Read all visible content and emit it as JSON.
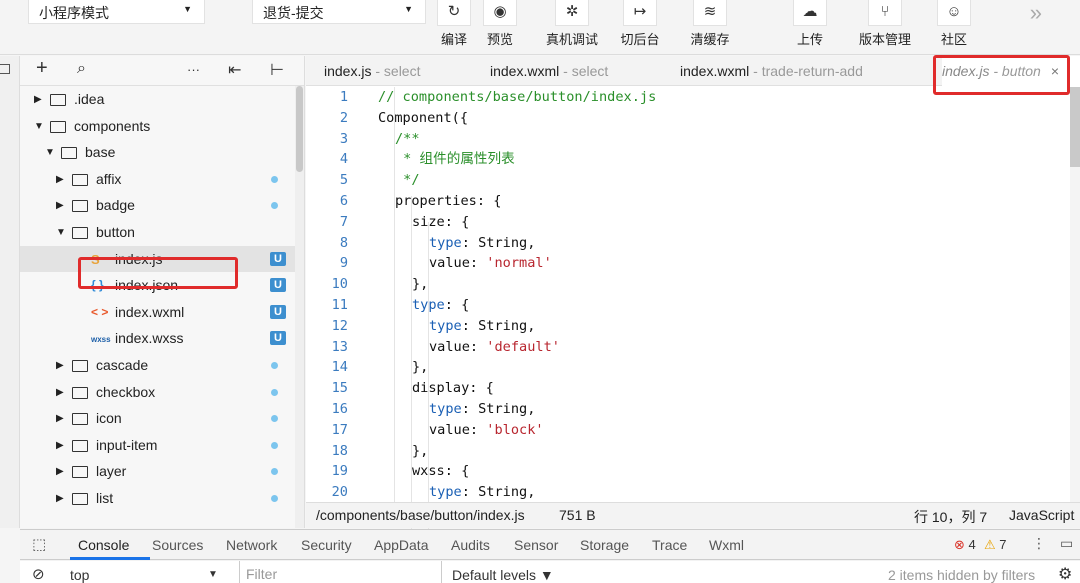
{
  "toolbar": {
    "mode_select": "小程序模式",
    "compile_select": "退货-提交",
    "buttons": [
      {
        "label": "编译",
        "icon": "refresh-icon",
        "glyph": "↻"
      },
      {
        "label": "预览",
        "icon": "eye-icon",
        "glyph": "◉"
      },
      {
        "label": "真机调试",
        "icon": "bug-icon",
        "glyph": "✲"
      },
      {
        "label": "切后台",
        "icon": "switch-background-icon",
        "glyph": "↦"
      },
      {
        "label": "清缓存",
        "icon": "layers-icon",
        "glyph": "≋"
      },
      {
        "label": "上传",
        "icon": "cloud-upload-icon",
        "glyph": "☁"
      },
      {
        "label": "版本管理",
        "icon": "branch-icon",
        "glyph": "⑂"
      },
      {
        "label": "社区",
        "icon": "chat-icon",
        "glyph": "☺"
      }
    ],
    "more_glyph": "»"
  },
  "explorer": {
    "tools": {
      "add": "+",
      "search": "⌕",
      "more": "···",
      "collapse": "⇤",
      "split": "⊢"
    },
    "tree": [
      {
        "name": ".idea",
        "level": 0,
        "type": "folder",
        "expanded": false
      },
      {
        "name": "components",
        "level": 0,
        "type": "folder",
        "expanded": true
      },
      {
        "name": "base",
        "level": 1,
        "type": "folder",
        "expanded": true
      },
      {
        "name": "affix",
        "level": 2,
        "type": "folder",
        "expanded": false,
        "status": "dot"
      },
      {
        "name": "badge",
        "level": 2,
        "type": "folder",
        "expanded": false,
        "status": "dot"
      },
      {
        "name": "button",
        "level": 2,
        "type": "folder",
        "expanded": true
      },
      {
        "name": "index.js",
        "level": 3,
        "type": "js",
        "status": "U",
        "selected": true
      },
      {
        "name": "index.json",
        "level": 3,
        "type": "json",
        "status": "U"
      },
      {
        "name": "index.wxml",
        "level": 3,
        "type": "wxml",
        "status": "U"
      },
      {
        "name": "index.wxss",
        "level": 3,
        "type": "wxss",
        "status": "U"
      },
      {
        "name": "cascade",
        "level": 2,
        "type": "folder",
        "expanded": false,
        "status": "dot"
      },
      {
        "name": "checkbox",
        "level": 2,
        "type": "folder",
        "expanded": false,
        "status": "dot"
      },
      {
        "name": "icon",
        "level": 2,
        "type": "folder",
        "expanded": false,
        "status": "dot"
      },
      {
        "name": "input-item",
        "level": 2,
        "type": "folder",
        "expanded": false,
        "status": "dot"
      },
      {
        "name": "layer",
        "level": 2,
        "type": "folder",
        "expanded": false,
        "status": "dot"
      },
      {
        "name": "list",
        "level": 2,
        "type": "folder",
        "expanded": false,
        "status": "dot"
      }
    ],
    "icon_glyphs": {
      "js": "S",
      "json": "{ }",
      "wxml": "< >",
      "wxss": "wxss"
    }
  },
  "editor": {
    "tabs": [
      {
        "file": "index.js",
        "dir": " - select"
      },
      {
        "file": "index.wxml",
        "dir": " - select"
      },
      {
        "file": "index.wxml",
        "dir": " - trade-return-add"
      },
      {
        "file": "index.js",
        "dir": " - button",
        "active": true,
        "close": "×"
      }
    ],
    "lines": [
      {
        "n": "1",
        "indent": 0,
        "t": [
          [
            "c-comment",
            "// components/base/button/index.js"
          ]
        ]
      },
      {
        "n": "2",
        "indent": 0,
        "t": [
          [
            "",
            "Component({"
          ]
        ]
      },
      {
        "n": "3",
        "indent": 1,
        "t": [
          [
            "c-comment",
            "/**"
          ]
        ]
      },
      {
        "n": "4",
        "indent": 1,
        "t": [
          [
            "c-comment",
            " * 组件的属性列表"
          ]
        ]
      },
      {
        "n": "5",
        "indent": 1,
        "t": [
          [
            "c-comment",
            " */"
          ]
        ]
      },
      {
        "n": "6",
        "indent": 1,
        "t": [
          [
            "",
            "properties: {"
          ]
        ]
      },
      {
        "n": "7",
        "indent": 2,
        "t": [
          [
            "",
            "size: {"
          ]
        ]
      },
      {
        "n": "8",
        "indent": 3,
        "t": [
          [
            "c-key",
            "type"
          ],
          [
            "",
            ": String,"
          ]
        ]
      },
      {
        "n": "9",
        "indent": 3,
        "t": [
          [
            "",
            "value: "
          ],
          [
            "c-str",
            "'normal'"
          ]
        ]
      },
      {
        "n": "10",
        "indent": 2,
        "t": [
          [
            "",
            "},"
          ]
        ]
      },
      {
        "n": "11",
        "indent": 2,
        "t": [
          [
            "c-key",
            "type"
          ],
          [
            "",
            ": {"
          ]
        ]
      },
      {
        "n": "12",
        "indent": 3,
        "t": [
          [
            "c-key",
            "type"
          ],
          [
            "",
            ": String,"
          ]
        ]
      },
      {
        "n": "13",
        "indent": 3,
        "t": [
          [
            "",
            "value: "
          ],
          [
            "c-str",
            "'default'"
          ]
        ]
      },
      {
        "n": "14",
        "indent": 2,
        "t": [
          [
            "",
            "},"
          ]
        ]
      },
      {
        "n": "15",
        "indent": 2,
        "t": [
          [
            "",
            "display: {"
          ]
        ]
      },
      {
        "n": "16",
        "indent": 3,
        "t": [
          [
            "c-key",
            "type"
          ],
          [
            "",
            ": String,"
          ]
        ]
      },
      {
        "n": "17",
        "indent": 3,
        "t": [
          [
            "",
            "value: "
          ],
          [
            "c-str",
            "'block'"
          ]
        ]
      },
      {
        "n": "18",
        "indent": 2,
        "t": [
          [
            "",
            "},"
          ]
        ]
      },
      {
        "n": "19",
        "indent": 2,
        "t": [
          [
            "",
            "wxss: {"
          ]
        ]
      },
      {
        "n": "20",
        "indent": 3,
        "t": [
          [
            "c-key",
            "type"
          ],
          [
            "",
            ": String,"
          ]
        ]
      }
    ],
    "status": {
      "path": "/components/base/button/index.js",
      "size": "751 B",
      "cursor": "行 10，列 7",
      "language": "JavaScript"
    }
  },
  "devtools": {
    "tabs": [
      "Console",
      "Sources",
      "Network",
      "Security",
      "AppData",
      "Audits",
      "Sensor",
      "Storage",
      "Trace",
      "Wxml"
    ],
    "active_tab": "Console",
    "errors": "4",
    "warnings": "7",
    "context": "top",
    "filter_placeholder": "Filter",
    "levels": "Default levels ▼",
    "hidden": "2 items hidden by filters"
  },
  "colors": {
    "highlight": "#e02b2b",
    "accent": "#1a73e8",
    "badge": "#3d8fcf"
  }
}
